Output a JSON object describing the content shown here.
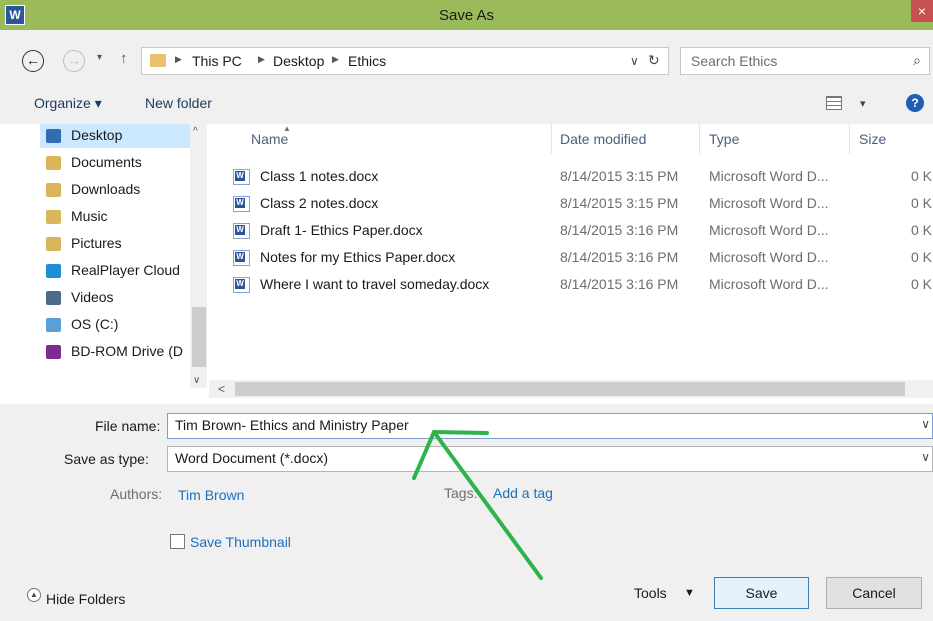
{
  "window": {
    "title": "Save As",
    "app_icon": "W",
    "close_glyph": "×"
  },
  "nav": {
    "back_glyph": "←",
    "forward_glyph": "→",
    "recent_glyph": "▾",
    "up_glyph": "↑",
    "breadcrumb": [
      "This PC",
      "Desktop",
      "Ethics"
    ],
    "crumb_sep": "▶",
    "dropdown_glyph": "∨",
    "refresh_glyph": "↻",
    "search_placeholder": "Search Ethics",
    "search_glyph": "⌕"
  },
  "toolbar": {
    "organize": "Organize ▾",
    "new_folder": "New folder",
    "view_caret": "▾",
    "help_glyph": "?"
  },
  "sidebar": {
    "scroll_up": "^",
    "scroll_down": "∨",
    "items": [
      {
        "label": "Desktop",
        "icon": "desktop-folder-icon",
        "color": "#2f6db5",
        "selected": true
      },
      {
        "label": "Documents",
        "icon": "documents-folder-icon",
        "color": "#d9b65a"
      },
      {
        "label": "Downloads",
        "icon": "downloads-folder-icon",
        "color": "#d9b65a"
      },
      {
        "label": "Music",
        "icon": "music-folder-icon",
        "color": "#d9b65a"
      },
      {
        "label": "Pictures",
        "icon": "pictures-folder-icon",
        "color": "#d9b65a"
      },
      {
        "label": "RealPlayer Cloud",
        "icon": "realplayer-cloud-icon",
        "color": "#1e8fd6"
      },
      {
        "label": "Videos",
        "icon": "videos-folder-icon",
        "color": "#4a6b8a"
      },
      {
        "label": "OS (C:)",
        "icon": "drive-icon",
        "color": "#5aa0d8"
      },
      {
        "label": "BD-ROM Drive (D",
        "icon": "bd-rom-drive-icon",
        "color": "#7b2c8f"
      }
    ]
  },
  "files": {
    "columns": {
      "name": "Name",
      "date": "Date modified",
      "type": "Type",
      "size": "Size"
    },
    "sort_glyph": "▲",
    "hscroll_left": "<",
    "rows": [
      {
        "name": "Class 1 notes.docx",
        "date": "8/14/2015 3:15 PM",
        "type": "Microsoft Word D...",
        "size": "0 K"
      },
      {
        "name": "Class 2 notes.docx",
        "date": "8/14/2015 3:15 PM",
        "type": "Microsoft Word D...",
        "size": "0 K"
      },
      {
        "name": "Draft 1- Ethics Paper.docx",
        "date": "8/14/2015 3:16 PM",
        "type": "Microsoft Word D...",
        "size": "0 K"
      },
      {
        "name": "Notes for my Ethics Paper.docx",
        "date": "8/14/2015 3:16 PM",
        "type": "Microsoft Word D...",
        "size": "0 K"
      },
      {
        "name": "Where I want to travel someday.docx",
        "date": "8/14/2015 3:16 PM",
        "type": "Microsoft Word D...",
        "size": "0 K"
      }
    ]
  },
  "form": {
    "file_name_label": "File name:",
    "file_name_value": "Tim Brown- Ethics and Ministry Paper",
    "save_type_label": "Save as type:",
    "save_type_value": "Word Document (*.docx)",
    "dropdown_glyph": "∨",
    "authors_label": "Authors:",
    "authors_value": "Tim Brown",
    "tags_label": "Tags:",
    "tags_value": "Add a tag",
    "thumbnail_label": "Save Thumbnail",
    "hide_folders_glyph": "▲",
    "hide_folders": "Hide Folders",
    "tools": "Tools",
    "tools_caret": "▼",
    "save": "Save",
    "cancel": "Cancel"
  },
  "annotation": {
    "color": "#2db34a",
    "shape": "arrow"
  }
}
